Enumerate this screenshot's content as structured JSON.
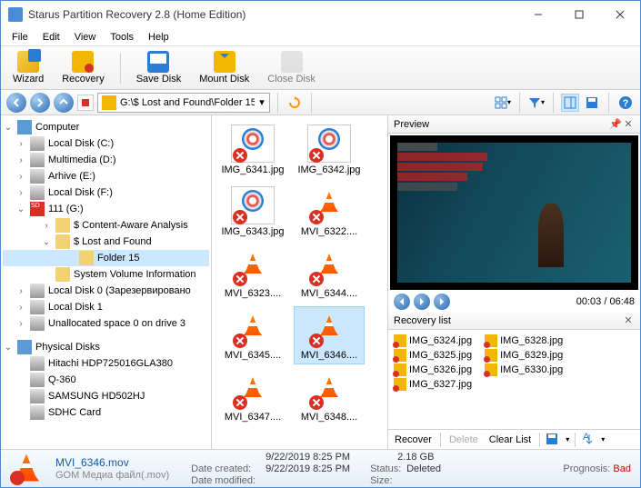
{
  "title": "Starus Partition Recovery 2.8 (Home Edition)",
  "menu": {
    "file": "File",
    "edit": "Edit",
    "view": "View",
    "tools": "Tools",
    "help": "Help"
  },
  "toolbar": {
    "wizard": "Wizard",
    "recovery": "Recovery",
    "save": "Save Disk",
    "mount": "Mount Disk",
    "close": "Close Disk"
  },
  "address": "G:\\$ Lost and Found\\Folder 15",
  "tree": {
    "computer": "Computer",
    "drives": [
      "Local Disk (C:)",
      "Multimedia (D:)",
      "Arhive (E:)",
      "Local Disk (F:)"
    ],
    "g": {
      "label": "111 (G:)",
      "children": [
        "$ Content-Aware Analysis",
        "$ Lost and Found",
        "Folder 15",
        "System Volume Information"
      ]
    },
    "drives2": [
      "Local Disk 0 (Зарезервировано",
      "Local Disk 1",
      "Unallocated space 0 on drive 3"
    ],
    "physical": "Physical Disks",
    "disks": [
      "Hitachi HDP725016GLA380",
      "Q-360",
      "SAMSUNG HD502HJ",
      "SDHC Card"
    ]
  },
  "thumbs": [
    {
      "name": "IMG_6341.jpg",
      "type": "img"
    },
    {
      "name": "IMG_6342.jpg",
      "type": "img"
    },
    {
      "name": "IMG_6343.jpg",
      "type": "img"
    },
    {
      "name": "MVI_6322....",
      "type": "vid"
    },
    {
      "name": "MVI_6323....",
      "type": "vid"
    },
    {
      "name": "MVI_6344....",
      "type": "vid"
    },
    {
      "name": "MVI_6345....",
      "type": "vid"
    },
    {
      "name": "MVI_6346....",
      "type": "vid",
      "selected": true
    },
    {
      "name": "MVI_6347....",
      "type": "vid"
    },
    {
      "name": "MVI_6348....",
      "type": "vid"
    }
  ],
  "preview": {
    "title": "Preview",
    "time": "00:03 / 06:48"
  },
  "recovery": {
    "title": "Recovery list",
    "col1": [
      "IMG_6324.jpg",
      "IMG_6325.jpg",
      "IMG_6326.jpg",
      "IMG_6327.jpg"
    ],
    "col2": [
      "IMG_6328.jpg",
      "IMG_6329.jpg",
      "IMG_6330.jpg"
    ],
    "tb": {
      "recover": "Recover",
      "delete": "Delete",
      "clear": "Clear List"
    }
  },
  "status": {
    "name": "MVI_6346.mov",
    "type": "GOM Медиа файл(.mov)",
    "mod_l": "Date modified:",
    "mod_v": "9/22/2019 8:25 PM",
    "cre_l": "Date created:",
    "cre_v": "9/22/2019 8:25 PM",
    "size_l": "Size:",
    "size_v": "2.18 GB",
    "stat_l": "Status:",
    "stat_v": "Deleted",
    "prog_l": "Prognosis:",
    "prog_v": "Bad"
  }
}
